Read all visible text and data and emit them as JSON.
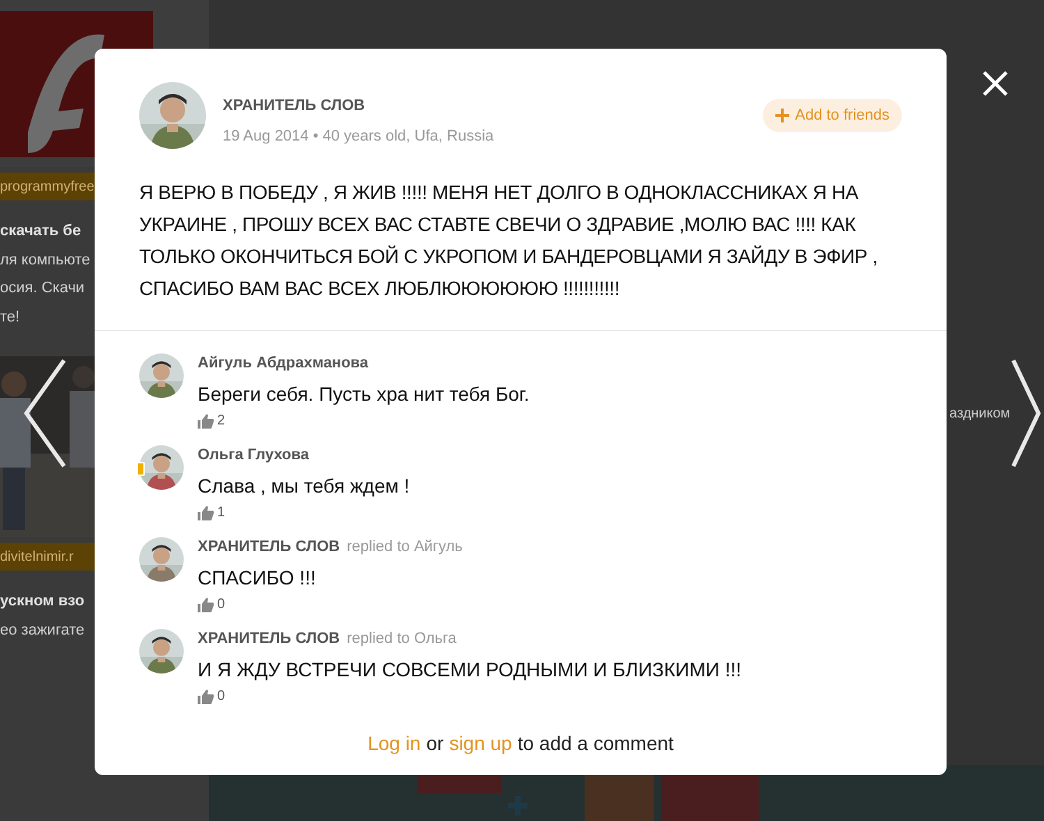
{
  "background": {
    "left_column": [
      {
        "kind": "picture"
      },
      {
        "kind": "source",
        "text": "programmyfree"
      },
      {
        "kind": "title",
        "text": "скачать бе"
      },
      {
        "kind": "text",
        "text": "ля компьюте"
      },
      {
        "kind": "text",
        "text": "осия. Скачи"
      },
      {
        "kind": "text",
        "text": "те!"
      },
      {
        "kind": "picture"
      },
      {
        "kind": "source",
        "text": "divitelnimir.r"
      },
      {
        "kind": "title",
        "text": "ускном взо"
      },
      {
        "kind": "text",
        "text": "ео зажигате"
      }
    ],
    "right_text": "аздником"
  },
  "post": {
    "author": "ХРАНИТЕЛЬ СЛОВ",
    "meta": "19 Aug 2014 • 40 years old, Ufa, Russia",
    "add_friends": "Add to friends",
    "text": "Я ВЕРЮ В ПОБЕДУ , Я ЖИВ !!!!! МЕНЯ НЕТ ДОЛГО В ОДНОКЛАССНИКАХ Я НА УКРАИНЕ , ПРОШУ ВСЕХ ВАС СТАВТЕ СВЕЧИ О ЗДРАВИЕ ,МОЛЮ ВАС !!!! КАК ТОЛЬКО ОКОНЧИТЬСЯ БОЙ С УКРОПОМ И БАНДЕРОВЦАМИ Я ЗАЙДУ В ЭФИР , СПАСИБО ВАМ ВАС ВСЕХ ЛЮБЛЮЮЮЮЮЮ !!!!!!!!!!!"
  },
  "comments": [
    {
      "author": "Айгуль Абдрахманова",
      "text": "Береги себя. Пусть хра нит тебя Бог.",
      "likes": "2",
      "mobile": false
    },
    {
      "author": "Ольга Глухова",
      "text": "Слава , мы тебя ждем !",
      "likes": "1",
      "mobile": true
    },
    {
      "author": "ХРАНИТЕЛЬ СЛОВ",
      "reply_note": "replied to Айгуль",
      "text": "СПАСИБО !!!",
      "likes": "0",
      "mobile": false
    },
    {
      "author": "ХРАНИТЕЛЬ СЛОВ",
      "reply_note": "replied to Ольга",
      "text": "И Я ЖДУ ВСТРЕЧИ СОВСЕМИ РОДНЫМИ И БЛИЗКИМИ !!!",
      "likes": "0",
      "mobile": false
    }
  ],
  "footer": {
    "login": "Log in",
    "or": "or",
    "signup": "sign up",
    "rest": "to add a comment"
  }
}
